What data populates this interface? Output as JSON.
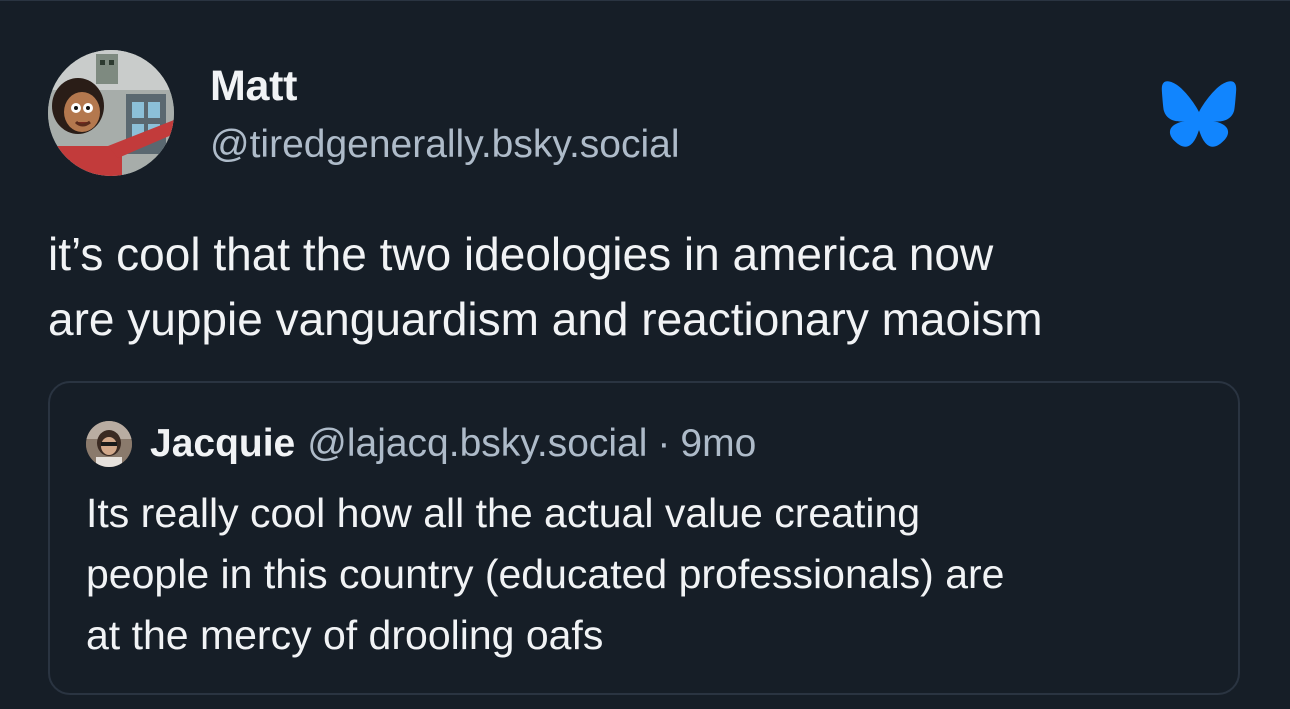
{
  "post": {
    "author": {
      "display_name": "Matt",
      "handle": "@tiredgenerally.bsky.social",
      "avatar_icon": "avatar-cartoon-icon"
    },
    "text": "it’s cool that the two ideologies in america now\nare yuppie vanguardism and reactionary maoism",
    "platform_icon": "bluesky-butterfly-icon",
    "quote": {
      "author": {
        "display_name": "Jacquie",
        "handle": "@lajacq.bsky.social",
        "avatar_icon": "avatar-photo-icon"
      },
      "separator": "·",
      "time": "9mo",
      "text": "Its really cool how all the actual value creating\npeople in this country (educated professionals) are\nat the mercy of drooling oafs"
    }
  },
  "colors": {
    "background": "#161e27",
    "text_primary": "#f1f3f5",
    "text_secondary": "#aebbc9",
    "border": "#2a3441",
    "brand": "#1185fe"
  }
}
